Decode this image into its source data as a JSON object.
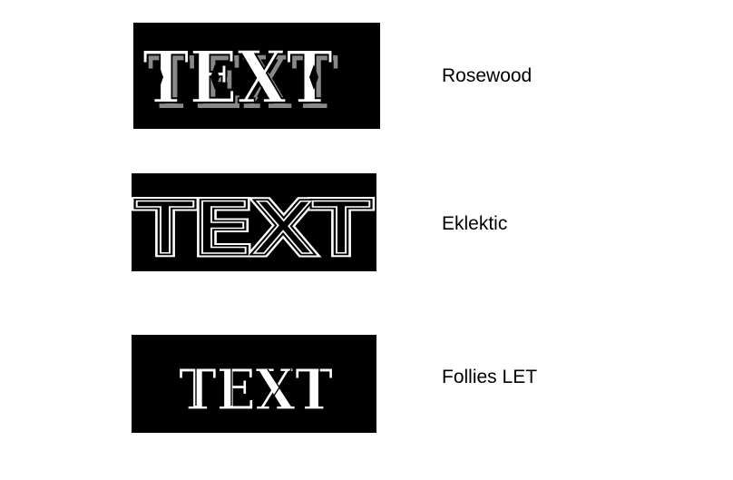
{
  "samples": [
    {
      "text": "TEXT",
      "font_name": "Rosewood"
    },
    {
      "text": "TEXT",
      "font_name": "Eklektic"
    },
    {
      "text": "TEXT",
      "font_name": "Follies LET"
    }
  ],
  "colors": {
    "background": "#ffffff",
    "sample_background": "#000000",
    "sample_text": "#ffffff",
    "label_text": "#000000"
  }
}
